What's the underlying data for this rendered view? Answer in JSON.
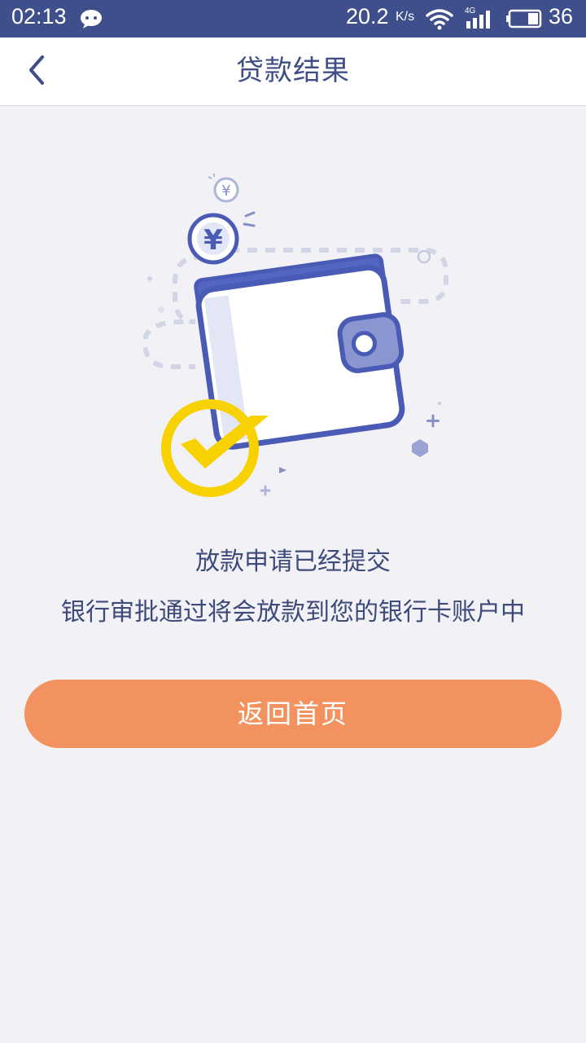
{
  "status_bar": {
    "time": "02:13",
    "speed": "20.2",
    "speed_unit": "K/s",
    "network_type": "4G",
    "battery": "36",
    "icons": [
      "wechat-icon",
      "wifi-icon",
      "signal-icon",
      "battery-icon"
    ],
    "background": "#3f4f8c"
  },
  "nav": {
    "title": "贷款结果",
    "back_icon": "chevron-left-icon"
  },
  "message": {
    "title": "放款申请已经提交",
    "subtitle": "银行审批通过将会放款到您的银行卡账户中"
  },
  "actions": {
    "home_button": "返回首页"
  },
  "illustration": {
    "description_icons": [
      "wallet-icon",
      "yuan-coin-icon",
      "checkmark-badge-icon"
    ]
  },
  "colors": {
    "accent": "#f2925e",
    "primary": "#4a5bb5",
    "text": "#3e4a7a",
    "check": "#f7d100"
  }
}
